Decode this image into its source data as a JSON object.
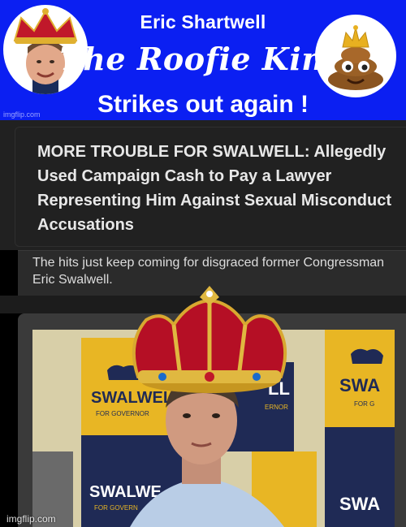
{
  "banner": {
    "name": "Eric Shartwell",
    "title": "The Roofie King",
    "subtitle": "Strikes out again !",
    "watermark": "imgflip.com",
    "colors": {
      "background": "#0b1ff2",
      "text": "#ffffff"
    },
    "left_image": "crowned-portrait",
    "right_image": "crowned-poop-emoji"
  },
  "article": {
    "headline": "MORE TROUBLE FOR SWALWELL: Allegedly Used Campaign Cash to Pay a Lawyer Representing Him Against Sexual Misconduct Accusations",
    "lede": "The hits just keep coming for disgraced former Congressman Eric Swalwell.",
    "colors": {
      "background": "#212121",
      "text": "#e8e8e8"
    }
  },
  "photo": {
    "signs": [
      {
        "text": "SWALWELL",
        "small": "FOR GOVERNOR"
      },
      {
        "text": "LL",
        "small": "ERNOR"
      },
      {
        "text": "SWA",
        "small": "FOR G"
      },
      {
        "text": "SWALWE",
        "small": "FOR GOVERN"
      },
      {
        "text": "SWA",
        "small": ""
      }
    ],
    "overlay": "crown-icon",
    "colors": {
      "sign_yellow": "#e8b624",
      "sign_navy": "#1f2a55"
    }
  },
  "footer": {
    "watermark": "imgflip.com"
  }
}
